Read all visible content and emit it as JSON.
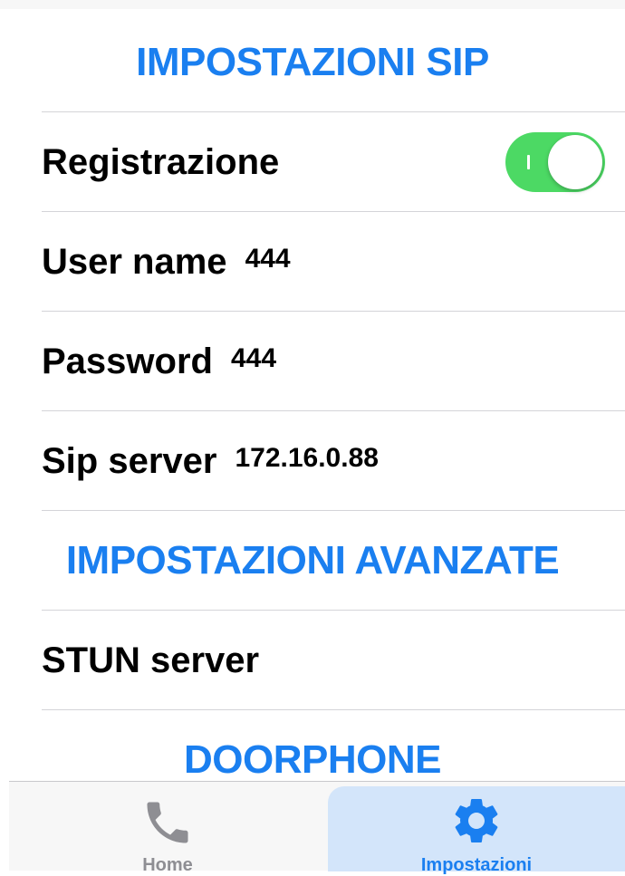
{
  "colors": {
    "accent": "#1a7ff0",
    "toggle_on": "#4cd964",
    "tab_inactive": "#8e8e93",
    "tab_active_bg": "#d3e5fa"
  },
  "sections": {
    "sip_header": "IMPOSTAZIONI SIP",
    "advanced_header": "IMPOSTAZIONI AVANZATE",
    "doorphone_header": "DOORPHONE"
  },
  "registration": {
    "label": "Registrazione",
    "enabled": true
  },
  "username": {
    "label": "User name",
    "value": "444"
  },
  "password": {
    "label": "Password",
    "value": "444"
  },
  "sip_server": {
    "label": "Sip server",
    "value": "172.16.0.88"
  },
  "stun_server": {
    "label": "STUN server",
    "value": ""
  },
  "tabbar": {
    "tabs": [
      {
        "label": "Home",
        "icon": "phone-icon",
        "active": false
      },
      {
        "label": "Impostazioni",
        "icon": "gear-icon",
        "active": true
      }
    ]
  }
}
